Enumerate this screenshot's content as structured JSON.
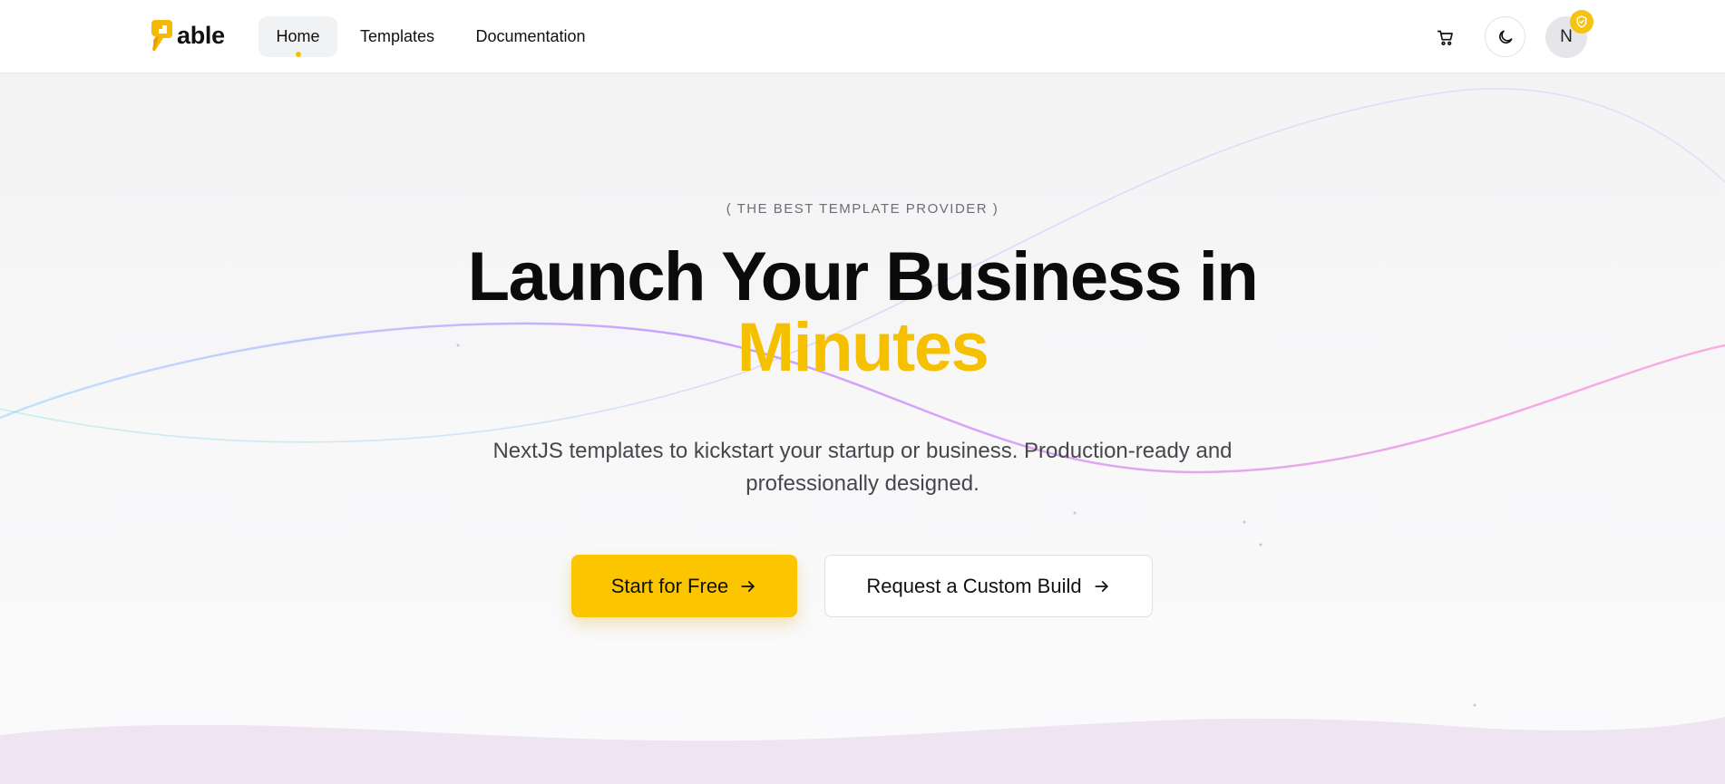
{
  "brand": {
    "name": "able",
    "accent_color": "#FBC600",
    "logo_icon": "able-logo-icon"
  },
  "nav": {
    "items": [
      {
        "label": "Home",
        "active": true
      },
      {
        "label": "Templates",
        "active": false
      },
      {
        "label": "Documentation",
        "active": false
      }
    ]
  },
  "header_actions": {
    "cart_icon": "cart-icon",
    "theme_icon": "moon-icon",
    "avatar_initial": "N",
    "avatar_badge_icon": "shield-check-icon"
  },
  "hero": {
    "eyebrow": "( THE BEST TEMPLATE PROVIDER )",
    "headline": "Launch Your Business in",
    "headline_accent": "Minutes",
    "subtitle": "NextJS templates to kickstart your startup or business. Production-ready and professionally designed.",
    "primary_cta": "Start for Free",
    "secondary_cta": "Request a Custom Build",
    "cta_icon": "arrow-right-icon"
  }
}
